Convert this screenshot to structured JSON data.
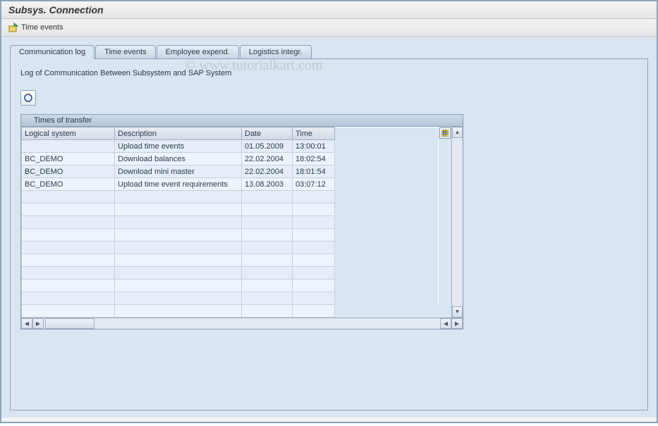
{
  "window": {
    "title": "Subsys. Connection"
  },
  "toolbar": {
    "time_events_label": "Time events"
  },
  "tabs": [
    {
      "id": "comm-log",
      "label": "Communication log",
      "active": true
    },
    {
      "id": "time-events",
      "label": "Time events",
      "active": false
    },
    {
      "id": "emp-expend",
      "label": "Employee expend.",
      "active": false
    },
    {
      "id": "log-integr",
      "label": "Logistics integr.",
      "active": false
    }
  ],
  "panel": {
    "description": "Log of Communication Between Subsystem and SAP System"
  },
  "grid": {
    "title": "Times of transfer",
    "columns": {
      "logical_system": "Logical system",
      "description": "Description",
      "date": "Date",
      "time": "Time"
    },
    "rows": [
      {
        "logical_system": "",
        "description": "Upload time events",
        "date": "01.05.2009",
        "time": "13:00:01"
      },
      {
        "logical_system": "BC_DEMO",
        "description": "Download balances",
        "date": "22.02.2004",
        "time": "18:02:54"
      },
      {
        "logical_system": "BC_DEMO",
        "description": "Download mini master",
        "date": "22.02.2004",
        "time": "18:01:54"
      },
      {
        "logical_system": "BC_DEMO",
        "description": "Upload time event requirements",
        "date": "13.08.2003",
        "time": "03:07:12"
      }
    ],
    "empty_rows": 10
  },
  "watermark": "© www.tutorialkart.com"
}
